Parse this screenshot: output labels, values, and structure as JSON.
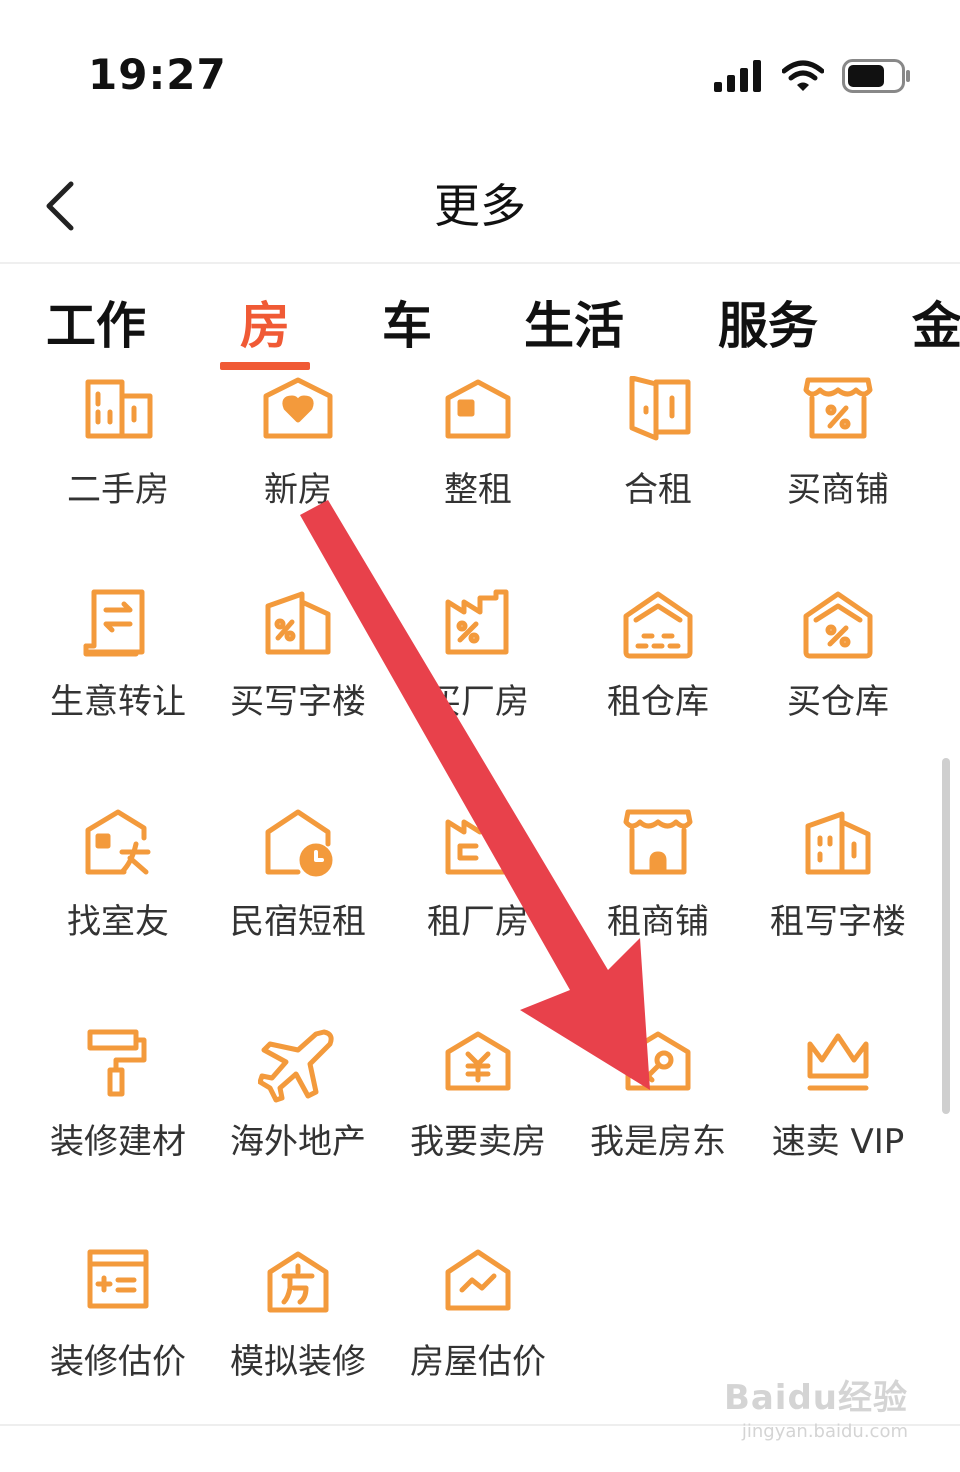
{
  "status_bar": {
    "time": "19:27"
  },
  "nav": {
    "title": "更多"
  },
  "tabs": [
    {
      "label": "工作",
      "active": false
    },
    {
      "label": "房",
      "active": true
    },
    {
      "label": "车",
      "active": false
    },
    {
      "label": "生活",
      "active": false
    },
    {
      "label": "服务",
      "active": false
    },
    {
      "label": "金",
      "active": false
    }
  ],
  "grid_items": [
    {
      "label": "二手房",
      "icon": "second-hand-house-icon"
    },
    {
      "label": "新房",
      "icon": "new-house-heart-icon"
    },
    {
      "label": "整租",
      "icon": "whole-rent-house-icon"
    },
    {
      "label": "合租",
      "icon": "shared-rent-door-icon"
    },
    {
      "label": "买商铺",
      "icon": "buy-shop-icon"
    },
    {
      "label": "生意转让",
      "icon": "business-transfer-icon"
    },
    {
      "label": "买写字楼",
      "icon": "buy-office-building-icon"
    },
    {
      "label": "买厂房",
      "icon": "buy-factory-icon"
    },
    {
      "label": "租仓库",
      "icon": "rent-warehouse-icon"
    },
    {
      "label": "买仓库",
      "icon": "buy-warehouse-icon"
    },
    {
      "label": "找室友",
      "icon": "find-roommate-icon"
    },
    {
      "label": "民宿短租",
      "icon": "homestay-clock-icon"
    },
    {
      "label": "租厂房",
      "icon": "rent-factory-icon"
    },
    {
      "label": "租商铺",
      "icon": "rent-shop-icon"
    },
    {
      "label": "租写字楼",
      "icon": "rent-office-building-icon"
    },
    {
      "label": "装修建材",
      "icon": "paint-roller-icon"
    },
    {
      "label": "海外地产",
      "icon": "airplane-icon"
    },
    {
      "label": "我要卖房",
      "icon": "sell-house-yen-icon"
    },
    {
      "label": "我是房东",
      "icon": "landlord-key-icon"
    },
    {
      "label": "速卖 VIP",
      "icon": "crown-icon"
    },
    {
      "label": "装修估价",
      "icon": "renovation-calculator-icon"
    },
    {
      "label": "模拟装修",
      "icon": "simulate-renovation-icon"
    },
    {
      "label": "房屋估价",
      "icon": "house-valuation-chart-icon"
    }
  ],
  "watermark": {
    "main": "Baidu经验",
    "sub": "jingyan.baidu.com"
  },
  "colors": {
    "accent": "#f05a35",
    "icon": "#f39a3c",
    "arrow": "#e8414b"
  }
}
